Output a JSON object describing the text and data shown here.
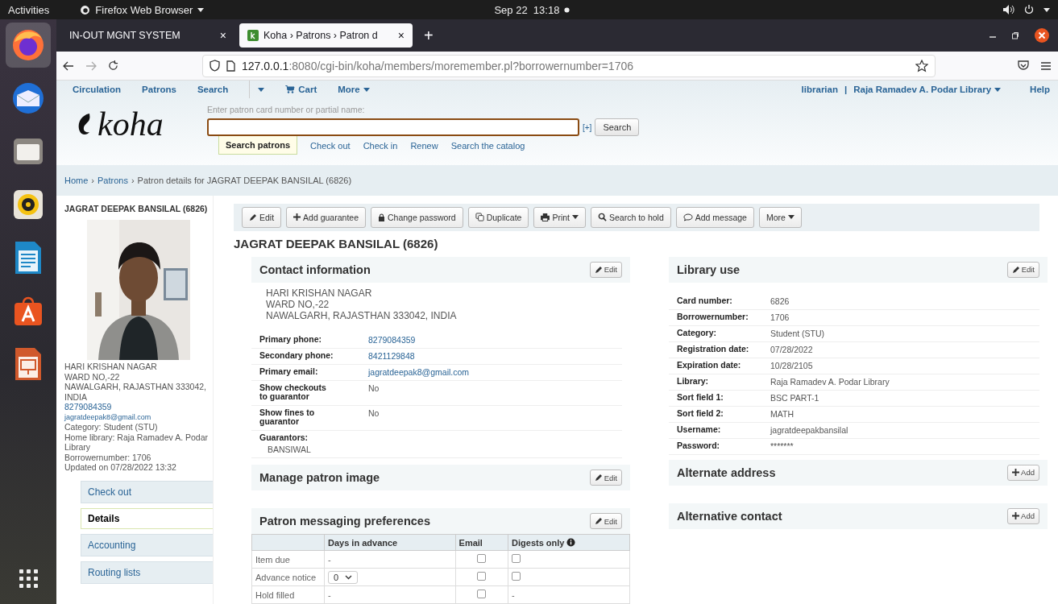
{
  "topbar": {
    "activities": "Activities",
    "app_menu": "Firefox Web Browser",
    "clock": "Sep 22  13:18"
  },
  "dock": {
    "items": [
      {
        "kind": "firefox",
        "selected": true
      },
      {
        "kind": "mail",
        "selected": false
      },
      {
        "kind": "files",
        "selected": false
      },
      {
        "kind": "music",
        "selected": false
      },
      {
        "kind": "writer",
        "selected": false
      },
      {
        "kind": "store",
        "selected": false
      },
      {
        "kind": "impress",
        "selected": false
      },
      {
        "kind": "grid",
        "selected": false
      }
    ]
  },
  "browser": {
    "tabs": [
      {
        "title": "IN-OUT MGNT SYSTEM",
        "selected": false,
        "close": "×"
      },
      {
        "title": "Koha › Patrons › Patron d",
        "selected": true,
        "close": "×"
      }
    ],
    "new_tab": "+",
    "url_host": "127.0.0.1",
    "url_rest": ":8080/cgi-bin/koha/members/moremember.pl?borrowernumber=1706"
  },
  "nav": {
    "left": [
      {
        "label": "Circulation",
        "dropdown": false
      },
      {
        "label": "Patrons",
        "dropdown": false
      },
      {
        "label": "Search",
        "dropdown": false
      },
      {
        "kind": "toggle",
        "dropdown": true
      },
      {
        "label": "Cart",
        "dropdown": false,
        "kind": "cart"
      },
      {
        "label": "More",
        "dropdown": true
      }
    ],
    "user": "librarian",
    "divider": "|",
    "library": "Raja Ramadev A. Podar Library",
    "help": "Help"
  },
  "logo": "koha",
  "search": {
    "label": "Enter patron card number or partial name:",
    "advanced": "[+]",
    "button": "Search",
    "tabs": [
      {
        "label": "Search patrons",
        "selected": true
      },
      {
        "label": "Check out",
        "selected": false
      },
      {
        "label": "Check in",
        "selected": false
      },
      {
        "label": "Renew",
        "selected": false
      },
      {
        "label": "Search the catalog",
        "selected": false
      }
    ]
  },
  "breadcrumb": {
    "separator": "›",
    "items": [
      "Home",
      "Patrons",
      "Patron details for JAGRAT DEEPAK BANSILAL (6826)"
    ]
  },
  "sidebar": {
    "name": "JAGRAT DEEPAK BANSILAL (6826)",
    "lines": [
      {
        "text": "HARI KRISHAN NAGAR",
        "kind": "text"
      },
      {
        "text": "WARD NO,-22",
        "kind": "text"
      },
      {
        "text": "NAWALGARH, RAJASTHAN 333042, INDIA",
        "kind": "text"
      },
      {
        "text": "8279084359",
        "kind": "link"
      },
      {
        "text": "jagratdeepak8@gmail.com",
        "kind": "small-link"
      },
      {
        "text": "Category: Student (STU)",
        "kind": "text"
      },
      {
        "text": "Home library: Raja Ramadev A. Podar Library",
        "kind": "text"
      },
      {
        "text": "Borrowernumber: 1706",
        "kind": "text"
      },
      {
        "text": "Updated on 07/28/2022 13:32",
        "kind": "text"
      }
    ],
    "menu": [
      {
        "label": "Check out",
        "selected": false
      },
      {
        "label": "Details",
        "selected": true
      },
      {
        "label": "Accounting",
        "selected": false
      },
      {
        "label": "Routing lists",
        "selected": false
      }
    ]
  },
  "toolbar": [
    {
      "label": "Edit",
      "kind": "edit",
      "dropdown": false
    },
    {
      "label": "Add guarantee",
      "kind": "add",
      "dropdown": false
    },
    {
      "label": "Change password",
      "kind": "lock",
      "dropdown": false
    },
    {
      "label": "Duplicate",
      "kind": "copy",
      "dropdown": false
    },
    {
      "label": "Print",
      "kind": "print",
      "dropdown": true
    },
    {
      "label": "Search to hold",
      "kind": "search",
      "dropdown": false
    },
    {
      "label": "Add message",
      "kind": "message",
      "dropdown": false
    },
    {
      "label": "More",
      "kind": "none",
      "dropdown": true
    }
  ],
  "title": "JAGRAT DEEPAK BANSILAL (6826)",
  "contact": {
    "heading": "Contact information",
    "action": {
      "label": "Edit",
      "kind": "edit"
    },
    "address": [
      "HARI KRISHAN NAGAR",
      "WARD NO,-22",
      "NAWALGARH, RAJASTHAN 333042, INDIA"
    ],
    "rows": [
      {
        "label": "Primary phone:",
        "value": "8279084359",
        "link": true
      },
      {
        "label": "Secondary phone:",
        "value": "8421129848",
        "link": true
      },
      {
        "label": "Primary email:",
        "value": "jagratdeepak8@gmail.com",
        "link": true
      },
      {
        "label": "Show checkouts to guarantor",
        "value": "No",
        "link": false
      },
      {
        "label": "Show fines to guarantor",
        "value": "No",
        "link": false
      }
    ],
    "guarantors_label": "Guarantors:",
    "guarantors": [
      "BANSIWAL"
    ]
  },
  "image_section": {
    "heading": "Manage patron image",
    "action": {
      "label": "Edit",
      "kind": "edit"
    }
  },
  "messaging": {
    "heading": "Patron messaging preferences",
    "action": {
      "label": "Edit",
      "kind": "edit"
    },
    "columns": [
      "",
      "Days in advance",
      "Email",
      "Digests only"
    ],
    "rows": [
      {
        "label": "Item due",
        "days": {
          "kind": "text",
          "value": "-"
        },
        "email": false,
        "digests": {
          "kind": "checkbox",
          "checked": false
        }
      },
      {
        "label": "Advance notice",
        "days": {
          "kind": "select",
          "value": "0"
        },
        "email": false,
        "digests": {
          "kind": "checkbox",
          "checked": false
        }
      },
      {
        "label": "Hold filled",
        "days": {
          "kind": "text",
          "value": "-"
        },
        "email": false,
        "digests": {
          "kind": "text",
          "value": "-"
        }
      }
    ]
  },
  "library_use": {
    "heading": "Library use",
    "action": {
      "label": "Edit",
      "kind": "edit"
    },
    "rows": [
      {
        "label": "Card number:",
        "value": "6826"
      },
      {
        "label": "Borrowernumber:",
        "value": "1706"
      },
      {
        "label": "Category:",
        "value": "Student (STU)"
      },
      {
        "label": "Registration date:",
        "value": "07/28/2022"
      },
      {
        "label": "Expiration date:",
        "value": "10/28/2105"
      },
      {
        "label": "Library:",
        "value": "Raja Ramadev A. Podar Library"
      },
      {
        "label": "Sort field 1:",
        "value": "BSC PART-1"
      },
      {
        "label": "Sort field 2:",
        "value": "MATH"
      },
      {
        "label": "Username:",
        "value": "jagratdeepakbansilal"
      },
      {
        "label": "Password:",
        "value": "*******"
      }
    ]
  },
  "alternate_address": {
    "heading": "Alternate address",
    "action": {
      "label": "Add",
      "kind": "add"
    }
  },
  "alternative_contact": {
    "heading": "Alternative contact",
    "action": {
      "label": "Add",
      "kind": "add"
    }
  }
}
